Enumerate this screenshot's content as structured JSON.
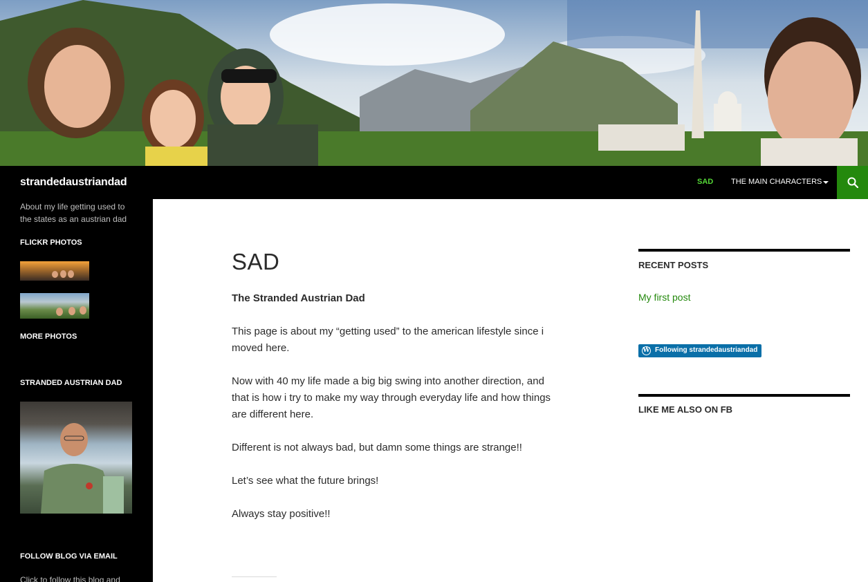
{
  "site": {
    "title": "strandedaustriandad",
    "tagline": "About my life getting used to the states as an austrian dad"
  },
  "nav": {
    "items": [
      {
        "label": "SAD",
        "active": true
      },
      {
        "label": "THE MAIN CHARACTERS",
        "has_dropdown": true
      }
    ],
    "search_icon": "search-icon",
    "accent_color": "#24890d",
    "active_color": "#55d737"
  },
  "left_sidebar": {
    "flickr_title": "FLICKR PHOTOS",
    "more_photos": "MORE PHOTOS",
    "image_widget_title": "STRANDED AUSTRIAN DAD",
    "email_title": "FOLLOW BLOG VIA EMAIL",
    "email_text": "Click to follow this blog and"
  },
  "page": {
    "title": "SAD",
    "paragraphs": [
      "The Stranded Austrian Dad",
      "This page is about my “getting used” to the american lifestyle since i moved here.",
      "Now with 40 my life made a big big swing into another direction, and that is how i try to make my way through everyday life and how things are different here.",
      "Different is not always bad, but damn some things are strange!!",
      "Let’s see what the future brings!",
      "Always stay positive!!"
    ]
  },
  "right_sidebar": {
    "recent_posts_title": "RECENT POSTS",
    "recent_posts": [
      "My first post"
    ],
    "follow_button": "Following strandedaustriandad",
    "fb_title": "LIKE ME ALSO ON FB"
  }
}
